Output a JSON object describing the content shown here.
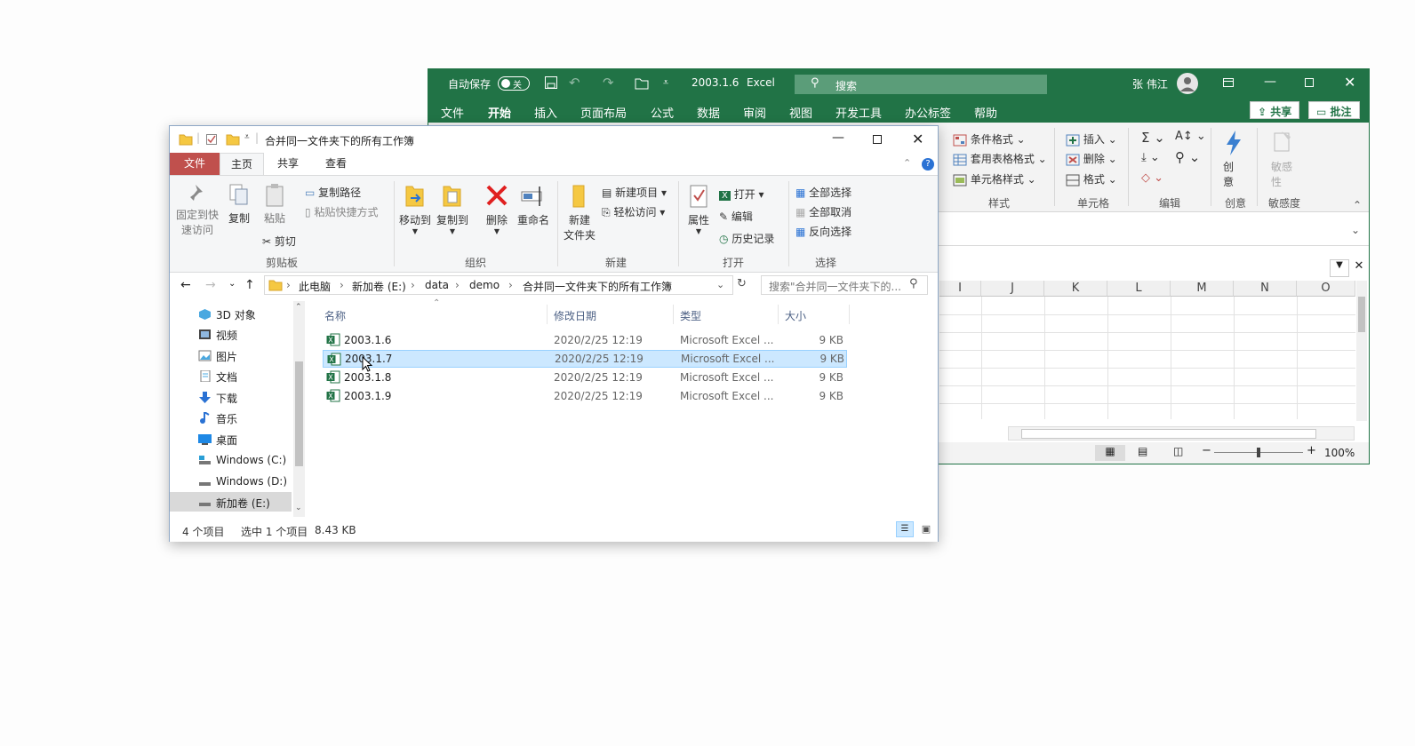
{
  "excel": {
    "autosave_label": "自动保存",
    "autosave_state": "关",
    "file_title": "2003.1.6",
    "app_name": "Excel",
    "search_placeholder": "搜索",
    "user_name": "张 伟江",
    "tabs": [
      "文件",
      "开始",
      "插入",
      "页面布局",
      "公式",
      "数据",
      "审阅",
      "视图",
      "开发工具",
      "办公标签",
      "帮助"
    ],
    "share_label": "共享",
    "comments_label": "批注",
    "ribbon": {
      "styles": {
        "conditional": "条件格式",
        "table": "套用表格格式",
        "cell": "单元格样式",
        "group": "样式"
      },
      "cells": {
        "insert": "插入",
        "delete": "删除",
        "format": "格式",
        "group": "单元格"
      },
      "editing": {
        "group": "编辑"
      },
      "creativity": {
        "label_1": "创",
        "label_2": "意",
        "group": "创意"
      },
      "sensitivity": {
        "label_1": "敏感",
        "label_2": "性",
        "group": "敏感度"
      }
    },
    "columns": [
      "I",
      "J",
      "K",
      "L",
      "M",
      "N",
      "O"
    ],
    "zoom": "100%",
    "accent_color": "#217346"
  },
  "explorer": {
    "title": "合并同一文件夹下的所有工作簿",
    "tabs": [
      "文件",
      "主页",
      "共享",
      "查看"
    ],
    "ribbon": {
      "clipboard": {
        "pin_1": "固定到快",
        "pin_2": "速访问",
        "copy": "复制",
        "paste": "粘贴",
        "copy_path": "复制路径",
        "paste_shortcut": "粘贴快捷方式",
        "cut": "剪切",
        "group": "剪贴板"
      },
      "organize": {
        "move_to": "移动到",
        "copy_to": "复制到",
        "delete": "删除",
        "rename": "重命名",
        "group": "组织"
      },
      "new": {
        "new_folder_1": "新建",
        "new_folder_2": "文件夹",
        "new_item": "新建项目",
        "easy_access": "轻松访问",
        "group": "新建"
      },
      "open": {
        "properties": "属性",
        "open": "打开",
        "edit": "编辑",
        "history": "历史记录",
        "group": "打开"
      },
      "select": {
        "select_all": "全部选择",
        "select_none": "全部取消",
        "invert": "反向选择",
        "group": "选择"
      }
    },
    "breadcrumb": [
      "此电脑",
      "新加卷 (E:)",
      "data",
      "demo",
      "合并同一文件夹下的所有工作簿"
    ],
    "search_placeholder": "搜索\"合并同一文件夹下的...",
    "nav": [
      {
        "label": "3D 对象",
        "icon": "cube-icon"
      },
      {
        "label": "视频",
        "icon": "video-icon"
      },
      {
        "label": "图片",
        "icon": "pictures-icon"
      },
      {
        "label": "文档",
        "icon": "documents-icon"
      },
      {
        "label": "下载",
        "icon": "download-icon"
      },
      {
        "label": "音乐",
        "icon": "music-icon"
      },
      {
        "label": "桌面",
        "icon": "desktop-icon"
      },
      {
        "label": "Windows (C:)",
        "icon": "drive-icon"
      },
      {
        "label": "Windows (D:)",
        "icon": "drive-icon"
      },
      {
        "label": "新加卷 (E:)",
        "icon": "drive-icon",
        "selected": true
      }
    ],
    "columns": {
      "name": "名称",
      "date": "修改日期",
      "type": "类型",
      "size": "大小"
    },
    "files": [
      {
        "name": "2003.1.6",
        "date": "2020/2/25 12:19",
        "type": "Microsoft Excel ...",
        "size": "9 KB",
        "selected": false
      },
      {
        "name": "2003.1.7",
        "date": "2020/2/25 12:19",
        "type": "Microsoft Excel ...",
        "size": "9 KB",
        "selected": true
      },
      {
        "name": "2003.1.8",
        "date": "2020/2/25 12:19",
        "type": "Microsoft Excel ...",
        "size": "9 KB",
        "selected": false
      },
      {
        "name": "2003.1.9",
        "date": "2020/2/25 12:19",
        "type": "Microsoft Excel ...",
        "size": "9 KB",
        "selected": false
      }
    ],
    "status": {
      "count": "4 个项目",
      "selected": "选中 1 个项目",
      "size": "8.43 KB"
    },
    "selection_color": "#cce8ff",
    "file_tab_color": "#c0504d"
  }
}
